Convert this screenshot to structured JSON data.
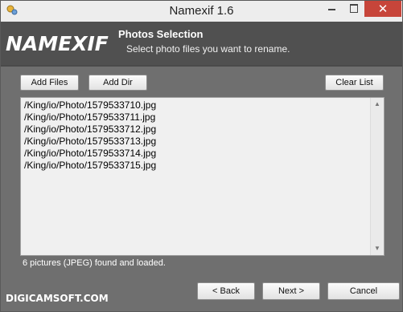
{
  "window": {
    "title": "Namexif 1.6",
    "close_glyph": "✕",
    "icons": [
      "app-icon",
      "minimize-icon",
      "maximize-icon",
      "close-icon"
    ]
  },
  "header": {
    "logo": "NAMEXIF",
    "section_title": "Photos Selection",
    "section_subtitle": "Select photo files you want to rename."
  },
  "toolbar": {
    "add_files_label": "Add Files",
    "add_dir_label": "Add Dir",
    "clear_list_label": "Clear List"
  },
  "file_list": {
    "items": [
      "/King/io/Photo/1579533710.jpg",
      "/King/io/Photo/1579533711.jpg",
      "/King/io/Photo/1579533712.jpg",
      "/King/io/Photo/1579533713.jpg",
      "/King/io/Photo/1579533714.jpg",
      "/King/io/Photo/1579533715.jpg"
    ],
    "scroll_up_glyph": "▲",
    "scroll_down_glyph": "▼"
  },
  "status": {
    "text": "6 pictures (JPEG) found and loaded."
  },
  "footer": {
    "brand": "DIGICAMSOFT.COM",
    "back_label": "< Back",
    "next_label": "Next >",
    "cancel_label": "Cancel"
  },
  "colors": {
    "body_bg": "#6f6f6f",
    "header_bg": "#505050",
    "close_button": "#c7453a",
    "list_bg": "#f0f0f0"
  }
}
